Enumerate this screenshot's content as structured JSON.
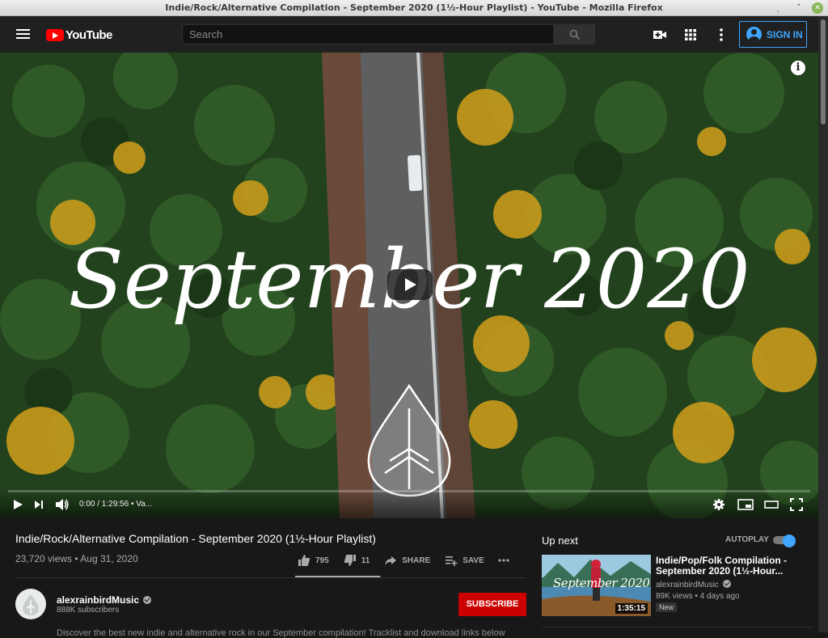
{
  "window": {
    "title": "Indie/Rock/Alternative Compilation - September 2020 (1½-Hour Playlist) - YouTube - Mozilla Firefox",
    "minimize": "˯",
    "maximize": "˄",
    "close": "✕"
  },
  "header": {
    "logo_text": "YouTube",
    "search_placeholder": "Search",
    "signin_label": "SIGN IN",
    "icons": [
      "menu-icon",
      "create-video-icon",
      "apps-grid-icon",
      "more-vert-icon",
      "search-icon",
      "account-icon"
    ]
  },
  "player": {
    "overlay_title": "September 2020",
    "time": "0:00 / 1:29:56",
    "chapter": "• Va...",
    "progress_fraction": 0,
    "icons": [
      "info-icon",
      "play-icon",
      "next-icon",
      "volume-icon",
      "settings-icon",
      "miniplayer-icon",
      "theater-icon",
      "fullscreen-icon"
    ]
  },
  "video": {
    "title": "Indie/Rock/Alternative Compilation - September 2020 (1½-Hour Playlist)",
    "views": "23,720 views",
    "date": "Aug 31, 2020",
    "meta_separator": " • ",
    "likes": "795",
    "dislikes": "11",
    "share_label": "SHARE",
    "save_label": "SAVE",
    "like_ratio": 0.986
  },
  "channel": {
    "name": "alexrainbirdMusic",
    "subscribers": "888K subscribers",
    "subscribe_label": "SUBSCRIBE",
    "description_peek": "Discover the best new indie and alternative rock in our September compilation! Tracklist and download links below"
  },
  "sidebar": {
    "up_next_label": "Up next",
    "autoplay_label": "AUTOPLAY",
    "autoplay_on": true,
    "cards": [
      {
        "title": "Indie/Pop/Folk Compilation - September 2020 (1½-Hour...",
        "thumb_text": "September 2020",
        "channel": "alexrainbirdMusic",
        "views": "89K views",
        "age": "4 days ago",
        "badge": "New",
        "duration": "1:35:15"
      }
    ]
  },
  "colors": {
    "accent_blue": "#3ea6ff",
    "subscribe_red": "#cc0000",
    "background": "#181818",
    "header": "#202020"
  }
}
